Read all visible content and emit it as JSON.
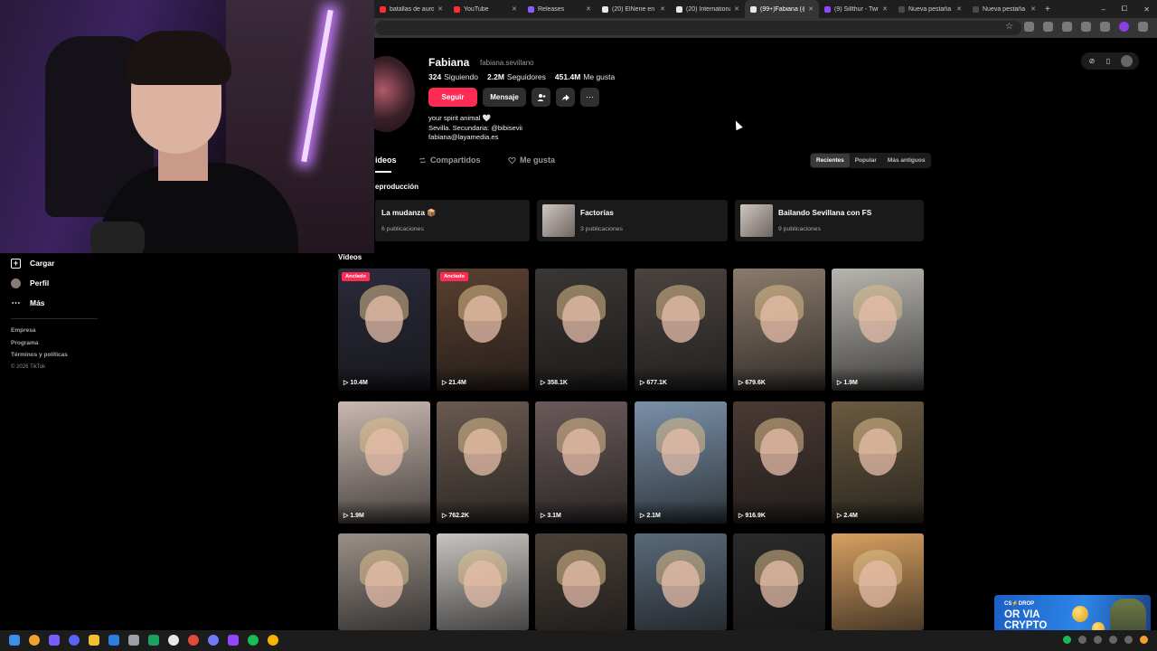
{
  "browser": {
    "tabs": [
      {
        "label": "batallas de auro",
        "color": "#ff2d2d",
        "active": false
      },
      {
        "label": "YouTube",
        "color": "#ff2d2d",
        "active": false
      },
      {
        "label": "Releases",
        "color": "#8a5cf6",
        "active": false
      },
      {
        "label": "(20) ElNene en X",
        "color": "#e8e8e8",
        "active": false
      },
      {
        "label": "(20) International",
        "color": "#e8e8e8",
        "active": false
      },
      {
        "label": "(99+)Fabiana (@",
        "color": "#e8e8e8",
        "active": true
      },
      {
        "label": "(9) Sillthur - Twitc",
        "color": "#9146ff",
        "active": false
      },
      {
        "label": "Nueva pestaña",
        "color": "#4a4a4a",
        "active": false
      },
      {
        "label": "Nueva pestaña",
        "color": "#4a4a4a",
        "active": false
      }
    ],
    "new_tab": "+",
    "window_controls": {
      "minimize": "–",
      "maximize": "⧠",
      "close": "✕"
    }
  },
  "sidebar": {
    "items": [
      {
        "label": "Cargar",
        "icon": "upload-icon"
      },
      {
        "label": "Perfil",
        "icon": "profile-avatar-icon"
      },
      {
        "label": "Más",
        "icon": "more-dots-icon"
      }
    ],
    "footer": [
      "Empresa",
      "Programa",
      "Términos y políticas"
    ],
    "copyright": "© 2026 TikTok"
  },
  "profile": {
    "name": "Fabiana",
    "handle": "fabiana.sevillano",
    "stats": [
      {
        "value": "324",
        "label": "Siguiendo"
      },
      {
        "value": "2.2M",
        "label": "Seguidores"
      },
      {
        "value": "451.4M",
        "label": "Me gusta"
      }
    ],
    "follow_label": "Seguir",
    "message_label": "Mensaje",
    "bio_line1": "your spirit animal",
    "bio_heart": "🤍",
    "bio_line2": "Sevilla. Secundaria: @bibisevii",
    "bio_line3": "fabiana@layamedia.es"
  },
  "tabs": {
    "videos": "ideos",
    "reposts": "Compartidos",
    "liked": "Me gusta"
  },
  "sort": {
    "options": [
      "Recientes",
      "Popular",
      "Más antiguos"
    ],
    "selected": "Recientes"
  },
  "playlists": {
    "section_label": "eproducción",
    "items": [
      {
        "title": "La mudanza 📦",
        "count": "6 publicaciones"
      },
      {
        "title": "Factorías",
        "count": "3 publicaciones"
      },
      {
        "title": "Bailando Sevillana con FS",
        "count": "9 publicaciones"
      }
    ]
  },
  "videos": {
    "section_label": "Vídeos",
    "pinned_label": "Anclado",
    "items": [
      {
        "views": "10.4M",
        "pinned": true,
        "tone": "#2a2a3a"
      },
      {
        "views": "21.4M",
        "pinned": true,
        "tone": "#5a4030"
      },
      {
        "views": "358.1K",
        "pinned": false,
        "tone": "#3a3633"
      },
      {
        "views": "677.1K",
        "pinned": false,
        "tone": "#4a4340"
      },
      {
        "views": "679.6K",
        "pinned": false,
        "tone": "#8a7a6a"
      },
      {
        "views": "1.9M",
        "pinned": false,
        "tone": "#b8b5b0"
      },
      {
        "views": "1.9M",
        "pinned": false,
        "tone": "#c9b8b0"
      },
      {
        "views": "762.2K",
        "pinned": false,
        "tone": "#6a5a50"
      },
      {
        "views": "3.1M",
        "pinned": false,
        "tone": "#6a5a5a"
      },
      {
        "views": "2.1M",
        "pinned": false,
        "tone": "#7a90a8"
      },
      {
        "views": "916.9K",
        "pinned": false,
        "tone": "#4a3a34"
      },
      {
        "views": "2.4M",
        "pinned": false,
        "tone": "#6a5a40"
      },
      {
        "views": "",
        "pinned": false,
        "tone": "#9a9088"
      },
      {
        "views": "",
        "pinned": false,
        "tone": "#c8c4c0"
      },
      {
        "views": "",
        "pinned": false,
        "tone": "#4a4038"
      },
      {
        "views": "",
        "pinned": false,
        "tone": "#5a6a7a"
      },
      {
        "views": "",
        "pinned": false,
        "tone": "#2a2a2a"
      },
      {
        "views": "",
        "pinned": false,
        "tone": "#d8a060"
      }
    ]
  },
  "ad": {
    "brand": "CS⚡DROP",
    "line1": "OR VIA",
    "line2": "CRYPTO",
    "small": "En Ongoin Transaction"
  },
  "colors": {
    "accent": "#fe2c55",
    "background": "#000000"
  }
}
